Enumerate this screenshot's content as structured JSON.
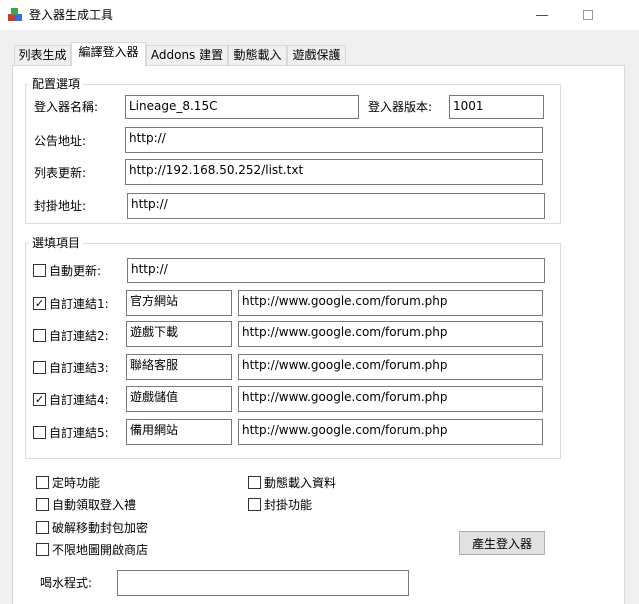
{
  "window": {
    "title": "登入器生成工具",
    "minimize_glyph": "—",
    "app_icon": "rgb-cubes-icon"
  },
  "tabs": [
    {
      "label": "列表生成",
      "active": false
    },
    {
      "label": "編譯登入器",
      "active": true
    },
    {
      "label": "Addons 建置",
      "active": false
    },
    {
      "label": "動態載入",
      "active": false
    },
    {
      "label": "遊戲保護",
      "active": false
    }
  ],
  "config": {
    "legend": "配置選項",
    "launcher_name_label": "登入器名稱:",
    "launcher_name_value": "Lineage_8.15C",
    "version_label": "登入器版本:",
    "version_value": "1001",
    "notice_label": "公告地址:",
    "notice_value": "http://",
    "list_update_label": "列表更新:",
    "list_update_value": "http://192.168.50.252/list.txt",
    "ban_label": "封掛地址:",
    "ban_value": "http://"
  },
  "options": {
    "legend": "選填項目",
    "auto_update_label": "自動更新:",
    "auto_update_checked": false,
    "auto_update_value": "http://",
    "links": [
      {
        "label": "自訂連結1:",
        "checked": true,
        "name": "官方網站",
        "url": "http://www.google.com/forum.php"
      },
      {
        "label": "自訂連結2:",
        "checked": false,
        "name": "遊戲下載",
        "url": "http://www.google.com/forum.php"
      },
      {
        "label": "自訂連結3:",
        "checked": false,
        "name": "聯絡客服",
        "url": "http://www.google.com/forum.php"
      },
      {
        "label": "自訂連結4:",
        "checked": true,
        "name": "遊戲儲值",
        "url": "http://www.google.com/forum.php"
      },
      {
        "label": "自訂連結5:",
        "checked": false,
        "name": "備用網站",
        "url": "http://www.google.com/forum.php"
      }
    ]
  },
  "features": {
    "timer": "定時功能",
    "auto_claim": "自動領取登入禮",
    "crack_encrypt": "破解移動封包加密",
    "shop_anywhere": "不限地圖開啟商店",
    "dynamic_load_data": "動態載入資料",
    "ban_function": "封掛功能"
  },
  "generate_button": "產生登入器",
  "drink_label": "喝水程式:",
  "drink_value": ""
}
